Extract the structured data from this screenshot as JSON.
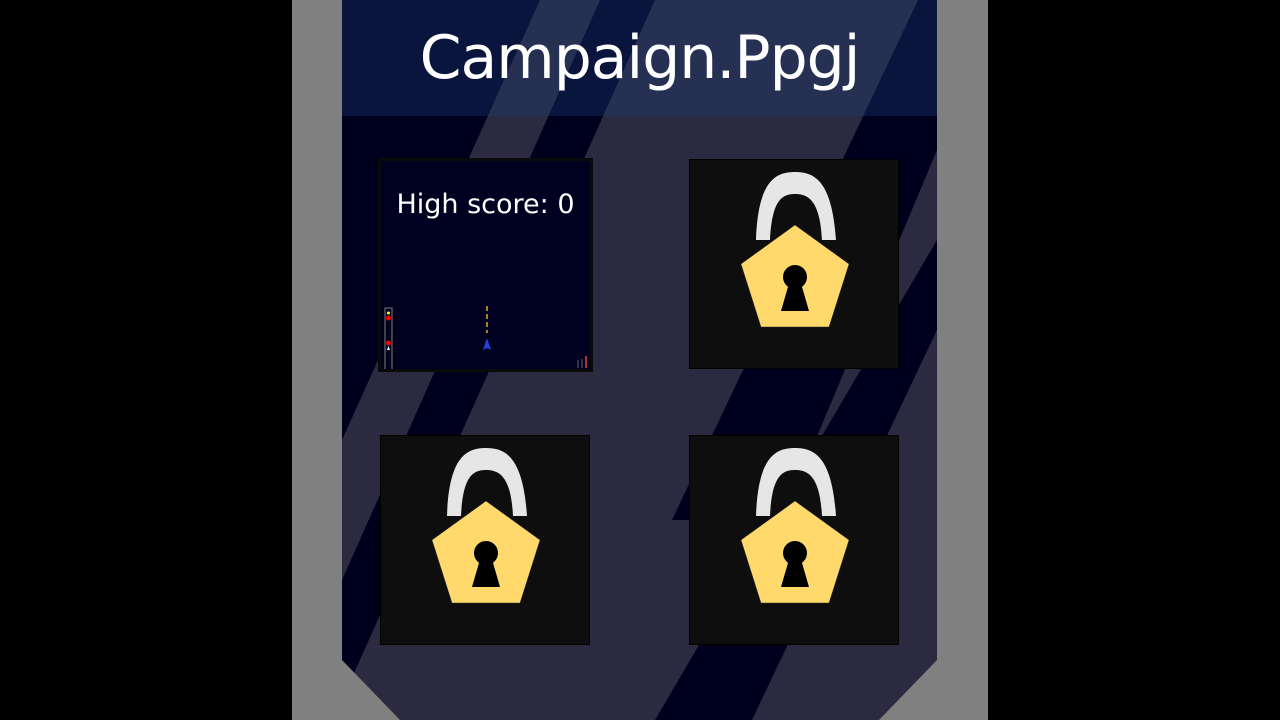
{
  "title": "Campaign.Ppgj",
  "levels": [
    {
      "state": "unlocked",
      "high_score_label": "High score:",
      "high_score": "0"
    },
    {
      "state": "locked"
    },
    {
      "state": "locked"
    },
    {
      "state": "locked"
    }
  ],
  "colors": {
    "lock_body": "#ffd96b",
    "lock_shackle": "#e6e6e6",
    "background_dark": "#00001e",
    "stripe": "#2c2a40",
    "frame": "#808080"
  }
}
